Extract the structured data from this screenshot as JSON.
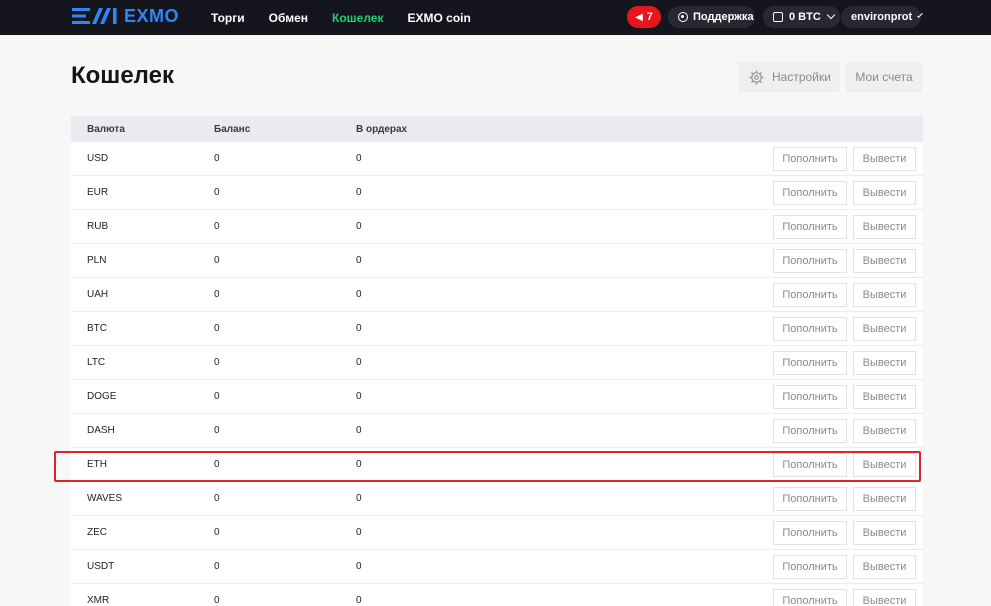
{
  "brand": {
    "name": "EXMO",
    "color": "#2f86f6"
  },
  "nav": [
    {
      "label": "Торги",
      "active": false
    },
    {
      "label": "Обмен",
      "active": false
    },
    {
      "label": "Кошелек",
      "active": true
    },
    {
      "label": "EXMO coin",
      "active": false
    }
  ],
  "topbar": {
    "notifications": "7",
    "support_label": "Поддержка",
    "balance_label": "0 BTC",
    "username": "environprot"
  },
  "page": {
    "title": "Кошелек",
    "settings_label": "Настройки",
    "accounts_label": "Мои счета"
  },
  "table": {
    "headers": [
      "Валюта",
      "Баланс",
      "В ордерах"
    ],
    "deposit_label": "Пополнить",
    "withdraw_label": "Вывести",
    "rows": [
      {
        "currency": "USD",
        "balance": "0",
        "in_orders": "0"
      },
      {
        "currency": "EUR",
        "balance": "0",
        "in_orders": "0"
      },
      {
        "currency": "RUB",
        "balance": "0",
        "in_orders": "0"
      },
      {
        "currency": "PLN",
        "balance": "0",
        "in_orders": "0"
      },
      {
        "currency": "UAH",
        "balance": "0",
        "in_orders": "0"
      },
      {
        "currency": "BTC",
        "balance": "0",
        "in_orders": "0"
      },
      {
        "currency": "LTC",
        "balance": "0",
        "in_orders": "0"
      },
      {
        "currency": "DOGE",
        "balance": "0",
        "in_orders": "0"
      },
      {
        "currency": "DASH",
        "balance": "0",
        "in_orders": "0"
      },
      {
        "currency": "ETH",
        "balance": "0",
        "in_orders": "0"
      },
      {
        "currency": "WAVES",
        "balance": "0",
        "in_orders": "0"
      },
      {
        "currency": "ZEC",
        "balance": "0",
        "in_orders": "0"
      },
      {
        "currency": "USDT",
        "balance": "0",
        "in_orders": "0"
      },
      {
        "currency": "XMR",
        "balance": "0",
        "in_orders": "0"
      }
    ]
  },
  "colors": {
    "nav_active": "#19d16e",
    "notification_badge": "#e8151f",
    "highlight": "#d9262b"
  }
}
